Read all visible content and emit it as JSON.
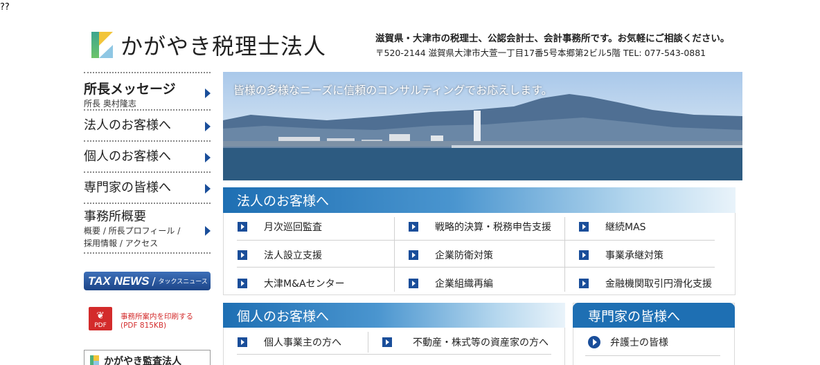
{
  "corner_text": "??",
  "header": {
    "logo_text": "かがやき税理士法人",
    "tagline": "滋賀県・大津市の税理士、公認会計士、会計事務所です。お気軽にご相談ください。",
    "address": "〒520-2144 滋賀県大津市大萱一丁目17番5号本郷第2ビル5階 TEL: 077-543-0881"
  },
  "sidebar": {
    "items": [
      {
        "label": "所長メッセージ",
        "sub": "所長 奥村隆志"
      },
      {
        "label": "法人のお客様へ"
      },
      {
        "label": "個人のお客様へ"
      },
      {
        "label": "専門家の皆様へ"
      },
      {
        "label": "事務所概要",
        "sub1": "概要 / 所長プロフィール /",
        "sub2": "採用情報 / アクセス"
      }
    ],
    "tax_news": {
      "big": "TAX NEWS",
      "sep": "/",
      "small": "タックスニュース"
    },
    "pdf": {
      "icon_label": "PDF",
      "line1": "事務所案内を印刷する",
      "line2": "(PDF 815KB)"
    },
    "kansa": "かがやき監査法人"
  },
  "hero": {
    "caption": "皆様の多様なニーズに信頼のコンサルティングでお応えします。"
  },
  "corporate": {
    "title": "法人のお客様へ",
    "items": [
      [
        "月次巡回監査",
        "戦略的決算・税務申告支援",
        "継続MAS"
      ],
      [
        "法人設立支援",
        "企業防衛対策",
        "事業承継対策"
      ],
      [
        "大津M&Aセンター",
        "企業組織再編",
        "金融機関取引円滑化支援"
      ]
    ]
  },
  "individual": {
    "title": "個人のお客様へ",
    "items": [
      "個人事業主の方へ",
      "不動産・株式等の資産家の方へ"
    ]
  },
  "professional": {
    "title": "専門家の皆様へ",
    "items": [
      "弁護士の皆様"
    ]
  },
  "colors": {
    "accent": "#1e6fb3",
    "arrow": "#1a4e9a",
    "pdf_red": "#d32b2b"
  }
}
